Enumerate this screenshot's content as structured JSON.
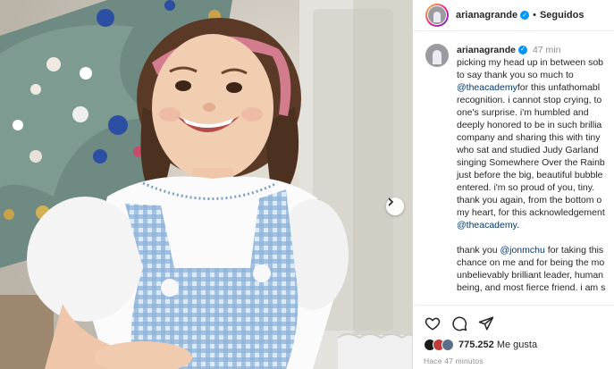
{
  "post": {
    "username": "arianagrande",
    "follow_label": "Seguidos",
    "separator": "•"
  },
  "caption": {
    "username": "arianagrande",
    "time": "47 min",
    "lines": [
      "picking my head up in between sob",
      "to say thank you so much to",
      "@theacademy|for this unfathomabl",
      "recognition. i cannot stop crying, to",
      "one's surprise. i'm humbled and",
      "deeply honored to be in such brillia",
      "company and sharing this with tiny",
      "who sat and studied Judy Garland",
      "singing Somewhere Over the Rainb",
      "just before the big, beautiful bubble",
      "entered. i'm so proud of you, tiny.",
      "thank you again, from the bottom o",
      "my heart, for this acknowledgement",
      "@theacademy|."
    ],
    "lines2": [
      "thank you |@jonmchu| for taking this",
      "chance on me and for being the mo",
      "unbelievably brilliant leader, human",
      "being, and most fierce friend. i am s"
    ]
  },
  "actions": {
    "likes_count": "775.252",
    "likes_label": "Me gusta",
    "time_ago": "Hace 47 minutos"
  },
  "colors": {
    "verified": "#0095f6",
    "mention": "#00376b",
    "text": "#262626",
    "muted": "#8e8e8e"
  },
  "icons": [
    "heart-icon",
    "comment-icon",
    "share-icon",
    "verified-icon",
    "next-arrow-icon"
  ]
}
